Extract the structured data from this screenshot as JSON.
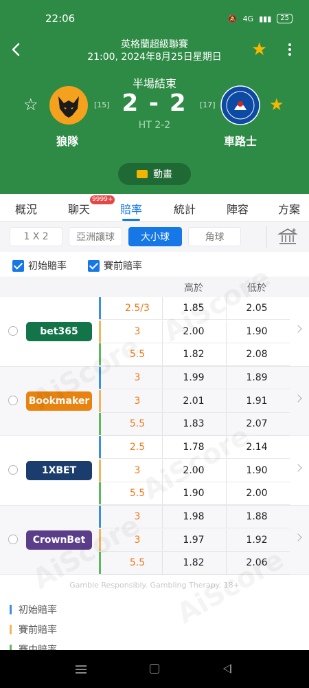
{
  "status_bar": {
    "time": "22:06",
    "battery": "25"
  },
  "header": {
    "league": "英格蘭超級聯賽",
    "datetime": "21:00, 2024年8月25日星期日",
    "match_status": "半場結束",
    "score": "2 - 2",
    "halftime": "HT 2-2",
    "home": {
      "name": "狼隊",
      "rank": "[15]"
    },
    "away": {
      "name": "車路士",
      "rank": "[17]"
    },
    "animation_label": "動畫"
  },
  "tabs": [
    {
      "label": "概況"
    },
    {
      "label": "聊天",
      "badge": "9999+"
    },
    {
      "label": "賠率",
      "active": true
    },
    {
      "label": "統計"
    },
    {
      "label": "陣容"
    },
    {
      "label": "方案"
    }
  ],
  "filters": [
    "1 X 2",
    "亞洲讓球",
    "大小球",
    "角球"
  ],
  "active_filter": "大小球",
  "checks": {
    "opening": "初始賠率",
    "prematch": "賽前賠率"
  },
  "table_header": {
    "over": "高於",
    "under": "低於"
  },
  "colors": {
    "opening": "#3b8fe0",
    "prematch": "#f0b65e",
    "inplay": "#5cb85c"
  },
  "bookmakers": [
    {
      "name": "bet365",
      "color": "#13744a",
      "rows": [
        {
          "line": "2.5/3",
          "over": "1.85",
          "under": "2.05"
        },
        {
          "line": "3",
          "over": "2.00",
          "under": "1.90"
        },
        {
          "line": "5.5",
          "over": "1.82",
          "under": "2.08"
        }
      ]
    },
    {
      "name": "Bookmaker",
      "color": "#e8830f",
      "rows": [
        {
          "line": "3",
          "over": "1.99",
          "under": "1.89"
        },
        {
          "line": "3",
          "over": "2.01",
          "under": "1.91"
        },
        {
          "line": "5.5",
          "over": "1.83",
          "under": "2.07"
        }
      ]
    },
    {
      "name": "1XBET",
      "color": "#1b3d6e",
      "rows": [
        {
          "line": "2.5",
          "over": "1.78",
          "under": "2.14"
        },
        {
          "line": "3",
          "over": "2.00",
          "under": "1.90"
        },
        {
          "line": "5.5",
          "over": "1.90",
          "under": "2.00"
        }
      ]
    },
    {
      "name": "CrownBet",
      "color": "#5b3e8a",
      "rows": [
        {
          "line": "3",
          "over": "1.98",
          "under": "1.88"
        },
        {
          "line": "3",
          "over": "1.97",
          "under": "1.92"
        },
        {
          "line": "5.5",
          "over": "1.82",
          "under": "2.06"
        }
      ]
    }
  ],
  "gamble_text": "Gamble Responsibly. Gambling Therapy. 18+",
  "legend": [
    "初始賠率",
    "賽前賠率",
    "賽中賠率"
  ],
  "watermark": "AiScore"
}
